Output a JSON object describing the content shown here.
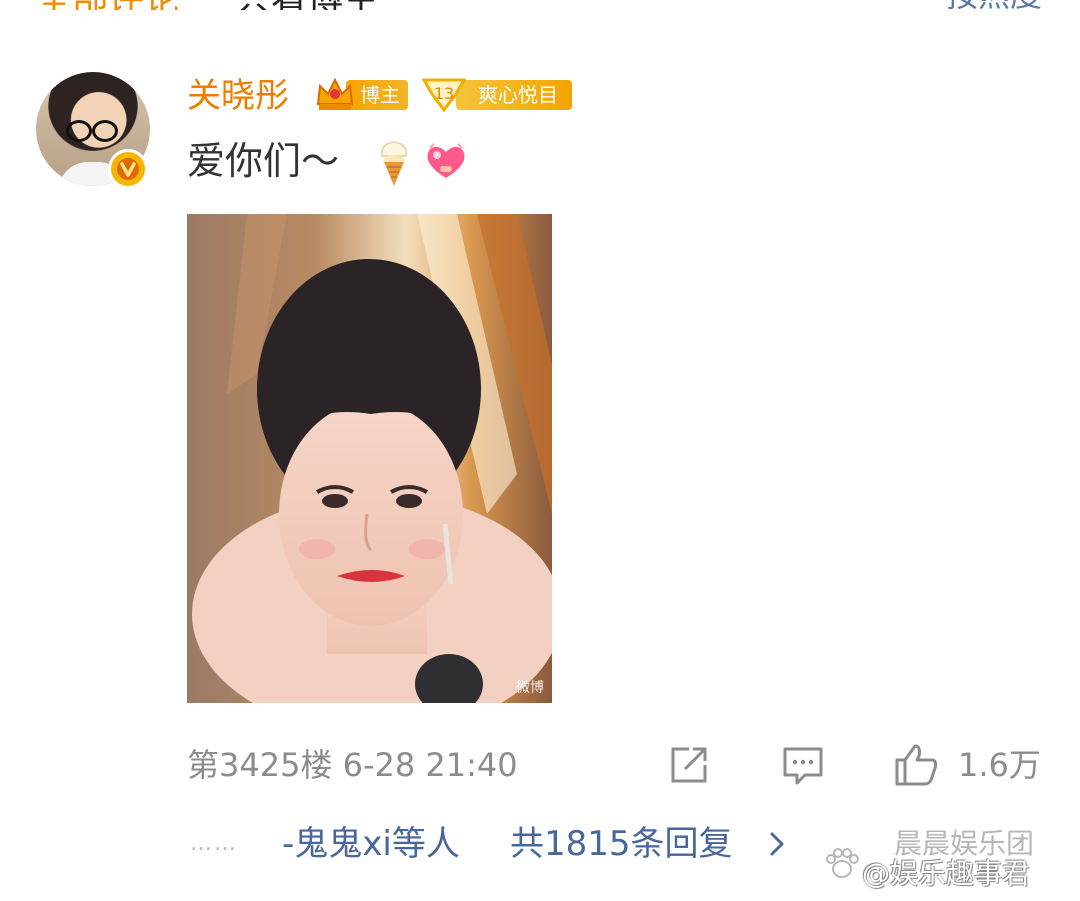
{
  "header": {
    "all_comments_label": "全部评论",
    "view_bloggers_label": "只看博主",
    "sort_label": "按热度"
  },
  "comment": {
    "username": "关晓彤",
    "badge_blogger": "博主",
    "fan_level": "13",
    "fan_badge_label": "爽心悦目",
    "text": "爱你们～",
    "emojis": [
      "ice-cream-icon",
      "heart-icon"
    ],
    "image_watermark": "微博",
    "floor": "第3425楼",
    "timestamp": "6-28 21:40",
    "like_count": "1.6万"
  },
  "replies": {
    "ellipsis": "……",
    "users_label": "-鬼鬼xi等人",
    "total_label": "共1815条回复"
  },
  "watermark": {
    "line1": "晨晨娱乐团",
    "line2": "@娱乐趣事君"
  },
  "colors": {
    "username": "#f07d00",
    "link": "#48679a",
    "meta": "#8c8c8c"
  }
}
